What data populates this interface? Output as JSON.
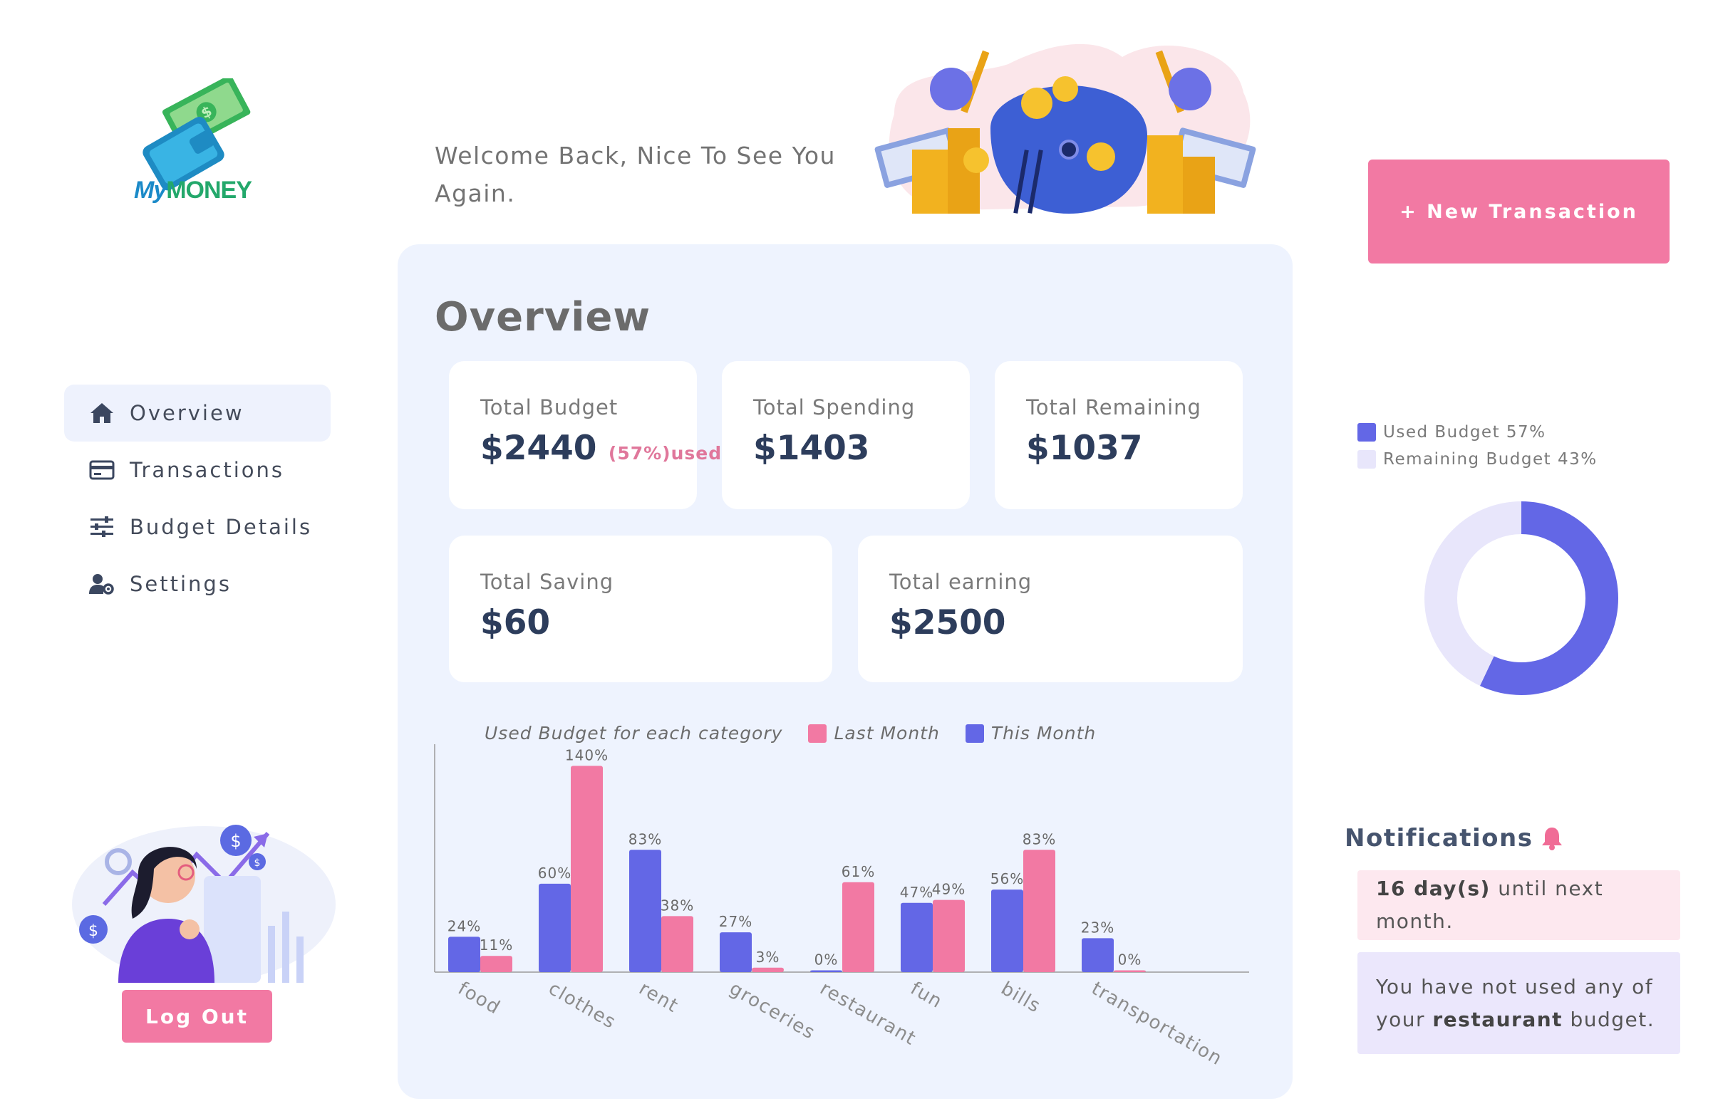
{
  "logo": {
    "my": "My",
    "money": "MONEY"
  },
  "sidebar": {
    "items": [
      {
        "label": "Overview",
        "icon": "home-icon",
        "active": true
      },
      {
        "label": "Transactions",
        "icon": "credit-card-icon",
        "active": false
      },
      {
        "label": "Budget Details",
        "icon": "sliders-icon",
        "active": false
      },
      {
        "label": "Settings",
        "icon": "user-gear-icon",
        "active": false
      }
    ],
    "logout_label": "Log Out"
  },
  "header": {
    "welcome": "Welcome Back, Nice To See You Again.",
    "new_transaction_label": "+ New Transaction"
  },
  "overview": {
    "title": "Overview",
    "cards": {
      "total_budget": {
        "label": "Total Budget",
        "value": "$2440",
        "note": "(57%)used"
      },
      "total_spending": {
        "label": "Total Spending",
        "value": "$1403"
      },
      "total_remaining": {
        "label": "Total Remaining",
        "value": "$1037"
      },
      "total_saving": {
        "label": "Total Saving",
        "value": "$60"
      },
      "total_earning": {
        "label": "Total earning",
        "value": "$2500"
      }
    }
  },
  "chart_data": [
    {
      "type": "bar",
      "title": "Used Budget for each category",
      "categories": [
        "food",
        "clothes",
        "rent",
        "groceries",
        "restaurant",
        "fun",
        "bills",
        "transportation"
      ],
      "series": [
        {
          "name": "This Month",
          "color": "#6367e6",
          "values": [
            24,
            60,
            83,
            27,
            0,
            47,
            56,
            23
          ],
          "labels": [
            "24%",
            "60%",
            "83%",
            "27%",
            "0%",
            "47%",
            "56%",
            "23%"
          ]
        },
        {
          "name": "Last Month",
          "color": "#f279a3",
          "values": [
            11,
            140,
            38,
            3,
            61,
            49,
            83,
            0
          ],
          "labels": [
            "11%",
            "140%",
            "38%",
            "3%",
            "61%",
            "49%",
            "83%",
            "0%"
          ]
        }
      ],
      "ylim": [
        0,
        145
      ],
      "grid": false,
      "legend": "top"
    },
    {
      "type": "pie",
      "slices": [
        {
          "name": "Used Budget 57%",
          "value": 57,
          "color": "#6367e6"
        },
        {
          "name": "Remaining Budget 43%",
          "value": 43,
          "color": "#e8e6fb"
        }
      ],
      "legend": "top-left"
    }
  ],
  "notifications": {
    "title": "Notifications",
    "items": [
      {
        "bold": "16 day(s)",
        "text": " until next month."
      },
      {
        "text1": "You have not used any of your ",
        "bold": "restaurant",
        "text2": " budget."
      }
    ]
  },
  "colors": {
    "accent": "#f279a3",
    "primary": "#6367e6",
    "panel": "#eef3fe"
  }
}
